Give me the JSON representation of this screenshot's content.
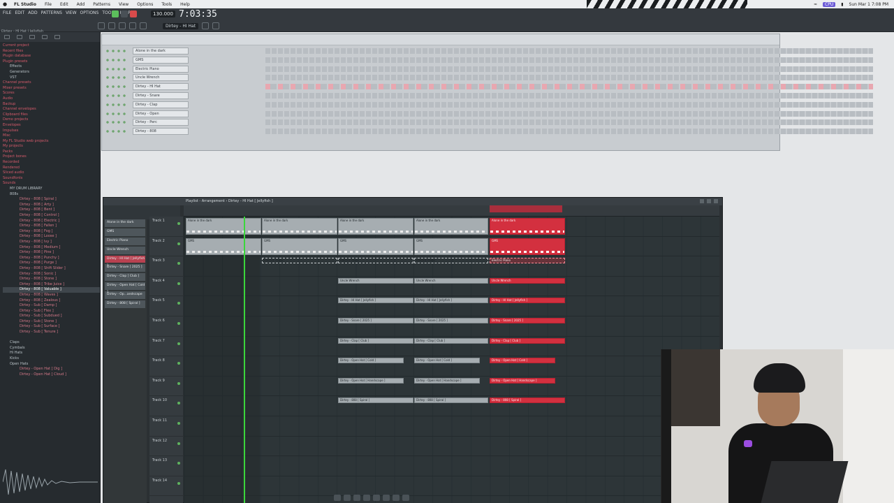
{
  "menubar": {
    "app": "FL Studio",
    "items": [
      "File",
      "Edit",
      "Add",
      "Patterns",
      "View",
      "Options",
      "Tools",
      "Help"
    ],
    "status_label": "CPU",
    "clock": "Sun Mar 1  7:08 PM"
  },
  "toolbar": {
    "menu": [
      "FILE",
      "EDIT",
      "ADD",
      "PATTERNS",
      "VIEW",
      "OPTIONS",
      "TOOLS",
      "HELP"
    ],
    "tempo": "130.000",
    "time": "7:03:35",
    "pattern": "Dirtey - HI Hat",
    "hint": "Dirtey - HI Hat | Jellyfish"
  },
  "browser": {
    "items": [
      {
        "label": "Current project",
        "kind": "folder"
      },
      {
        "label": "Recent files",
        "kind": "folder"
      },
      {
        "label": "Plugin database",
        "kind": "folder"
      },
      {
        "label": "Plugin presets",
        "kind": "folder"
      },
      {
        "label": "Effects",
        "kind": "sub"
      },
      {
        "label": "Generators",
        "kind": "sub"
      },
      {
        "label": "VST",
        "kind": "sub"
      },
      {
        "label": "Channel presets",
        "kind": "folder"
      },
      {
        "label": "Mixer presets",
        "kind": "folder"
      },
      {
        "label": "Scores",
        "kind": "folder"
      },
      {
        "label": "Audio",
        "kind": "folder"
      },
      {
        "label": "Backup",
        "kind": "folder"
      },
      {
        "label": "Channel envelopes",
        "kind": "folder"
      },
      {
        "label": "Clipboard files",
        "kind": "folder"
      },
      {
        "label": "Demo projects",
        "kind": "folder"
      },
      {
        "label": "Envelopes",
        "kind": "folder"
      },
      {
        "label": "Impulses",
        "kind": "folder"
      },
      {
        "label": "Misc",
        "kind": "folder"
      },
      {
        "label": "My FL Studio web projects",
        "kind": "folder"
      },
      {
        "label": "My projects",
        "kind": "folder"
      },
      {
        "label": "Packs",
        "kind": "folder"
      },
      {
        "label": "Project bones",
        "kind": "folder"
      },
      {
        "label": "Recorded",
        "kind": "folder"
      },
      {
        "label": "Rendered",
        "kind": "folder"
      },
      {
        "label": "Sliced audio",
        "kind": "folder"
      },
      {
        "label": "Soundfonts",
        "kind": "folder"
      },
      {
        "label": "Sounds",
        "kind": "folder"
      },
      {
        "label": "MY DRUM LIBRARY",
        "kind": "sub"
      },
      {
        "label": "808s",
        "kind": "sub"
      },
      {
        "label": "Dirtey - 808 [ Spiral ]",
        "kind": "sub2"
      },
      {
        "label": "Dirtey - 808 [ Arty ]",
        "kind": "sub2"
      },
      {
        "label": "Dirtey - 808 [ Bent ]",
        "kind": "sub2"
      },
      {
        "label": "Dirtey - 808 [ Control ]",
        "kind": "sub2"
      },
      {
        "label": "Dirtey - 808 [ Electric ]",
        "kind": "sub2"
      },
      {
        "label": "Dirtey - 808 [ Fallen ]",
        "kind": "sub2"
      },
      {
        "label": "Dirtey - 808 [ Fog ]",
        "kind": "sub2"
      },
      {
        "label": "Dirtey - 808 [ Loose ]",
        "kind": "sub2"
      },
      {
        "label": "Dirtey - 808 [ Ivy ]",
        "kind": "sub2"
      },
      {
        "label": "Dirtey - 808 [ Medium ]",
        "kind": "sub2"
      },
      {
        "label": "Dirtey - 808 [ Pine ]",
        "kind": "sub2"
      },
      {
        "label": "Dirtey - 808 [ Punchy ]",
        "kind": "sub2"
      },
      {
        "label": "Dirtey - 808 [ Purge ]",
        "kind": "sub2"
      },
      {
        "label": "Dirtey - 808 [ Shift Slider ]",
        "kind": "sub2"
      },
      {
        "label": "Dirtey - 808 [ Sonic ]",
        "kind": "sub2"
      },
      {
        "label": "Dirtey - 808 [ Stone ]",
        "kind": "sub2"
      },
      {
        "label": "Dirtey - 808 [ Tribe Juice ]",
        "kind": "sub2"
      },
      {
        "label": "Dirtey - 808 [ Valuable ]",
        "kind": "sub2 sel"
      },
      {
        "label": "Dirtey - 808 [ Waves ]",
        "kind": "sub2"
      },
      {
        "label": "Dirtey - 808 [ Zealous ]",
        "kind": "sub2"
      },
      {
        "label": "Dirtey - Sub [ Damp ]",
        "kind": "sub2"
      },
      {
        "label": "Dirtey - Sub [ Flex ]",
        "kind": "sub2"
      },
      {
        "label": "Dirtey - Sub [ Subdued ]",
        "kind": "sub2"
      },
      {
        "label": "Dirtey - Sub [ Stone ]",
        "kind": "sub2"
      },
      {
        "label": "Dirtey - Sub [ Surface ]",
        "kind": "sub2"
      },
      {
        "label": "Dirtey - Sub [ Tenure ]",
        "kind": "sub2"
      },
      {
        "label": "",
        "kind": "sub"
      },
      {
        "label": "Claps",
        "kind": "sub"
      },
      {
        "label": "Cymbals",
        "kind": "sub"
      },
      {
        "label": "Hi Hats",
        "kind": "sub"
      },
      {
        "label": "Kicks",
        "kind": "sub"
      },
      {
        "label": "Open Hats",
        "kind": "sub"
      },
      {
        "label": "Dirtey - Open Hat [ Dig ]",
        "kind": "sub2"
      },
      {
        "label": "Dirtey - Open Hat [ Cloud ]",
        "kind": "sub2"
      }
    ]
  },
  "channel_rack": {
    "title": "Channel rack",
    "channels": [
      {
        "name": "Alone in the dark",
        "active": false
      },
      {
        "name": "GMS",
        "active": false
      },
      {
        "name": "Electric Piano",
        "active": false
      },
      {
        "name": "Uncle Wrench",
        "active": false
      },
      {
        "name": "Dirtey - HI Hat",
        "active": true
      },
      {
        "name": "Dirtey - Snare",
        "active": false
      },
      {
        "name": "Dirtey - Clap",
        "active": false
      },
      {
        "name": "Dirtey - Open",
        "active": false
      },
      {
        "name": "Dirtey - Perc",
        "active": false
      },
      {
        "name": "Dirtey - 808",
        "active": false
      }
    ]
  },
  "playlist": {
    "title": "Playlist - Arrangement › Dirtey - HI Hat [ Jellyfish ]",
    "patterns": [
      {
        "label": "Alone in the dark",
        "sel": false
      },
      {
        "label": "GMS",
        "sel": false
      },
      {
        "label": "Electric Piano",
        "sel": false
      },
      {
        "label": "Uncle Wrench",
        "sel": false
      },
      {
        "label": "Dirtey - HI Hat [ Jellyfish ]",
        "sel": true
      },
      {
        "label": "Dirtey - Snare [ 2025 ]",
        "sel": false
      },
      {
        "label": "Dirtey - Clap [ Club ]",
        "sel": false
      },
      {
        "label": "Dirtey - Open Hat [ Cold ]",
        "sel": false
      },
      {
        "label": "Dirtey - Op...andscape",
        "sel": false
      },
      {
        "label": "Dirtey - 808 [ Spiral ]",
        "sel": false
      }
    ],
    "tracks": [
      "Track 1",
      "Track 2",
      "Track 3",
      "Track 4",
      "Track 5",
      "Track 6",
      "Track 7",
      "Track 8",
      "Track 9",
      "Track 10",
      "Track 11",
      "Track 12",
      "Track 13",
      "Track 14"
    ],
    "clip_labels": {
      "alone": "Alone in the dark",
      "gms": "GMS",
      "epiano": "Electric Piano",
      "uncle": "Uncle Wrench",
      "hihat": "Dirtey - HI Hat [ Jellyfish ]",
      "snare": "Dirtey - Snare [ 2025 ]",
      "clap": "Dirtey - Clap [ Club ]",
      "openhat": "Dirtey - Open Hat [ Cold ]",
      "openland": "Dirtey - Open Hat [ Handscape ]",
      "bass": "Dirtey - 808 [ Spiral ]"
    }
  },
  "colors": {
    "accent": "#d3303f",
    "playhead": "#3bd63b",
    "grid_bg": "#2d3538"
  }
}
